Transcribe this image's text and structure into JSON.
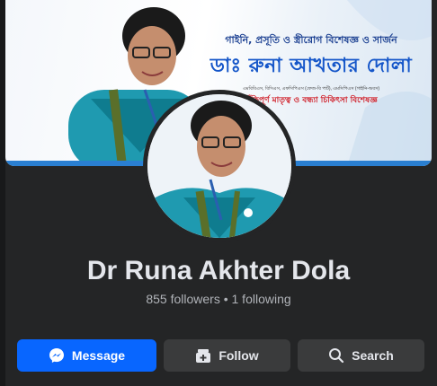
{
  "cover": {
    "line1": "গাইনি, প্রসূতি ও স্ত্রীরোগ বিশেষজ্ঞ ও সার্জন",
    "line2": "ডাঃ রুনা আখতার দোলা",
    "small": "এমবিবিএস, বিসিএস, এফসিপিএস (ফেজ-বি পার্ট), এমসিপিএস (গাইনি-অবস)",
    "red": "ঝুঁকিপূর্ণ মাতৃত্ব ও বন্ধ্যা চিকিৎসা বিশেষজ্ঞ"
  },
  "profile": {
    "name": "Dr Runa Akhter Dola",
    "stats": "855 followers • 1 following"
  },
  "actions": {
    "message": "Message",
    "follow": "Follow",
    "search": "Search"
  },
  "colors": {
    "primary": "#0866ff",
    "secondary_button": "#3a3b3c",
    "background": "#242526"
  },
  "icons": [
    "messenger-icon",
    "follow-icon",
    "search-icon"
  ]
}
